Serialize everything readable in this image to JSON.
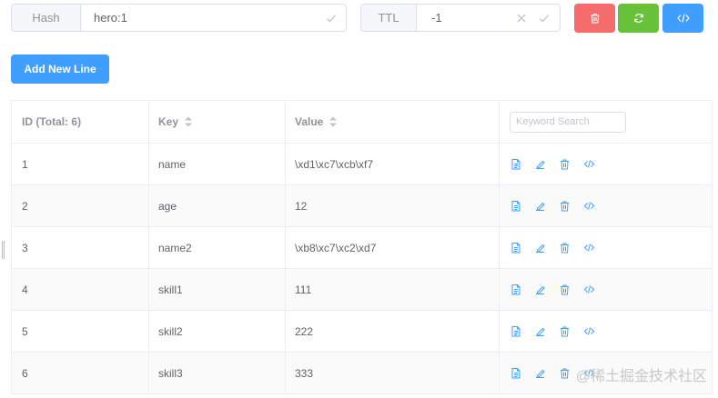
{
  "key_bar": {
    "type_label": "Hash",
    "key_name": "hero:1"
  },
  "ttl_bar": {
    "label": "TTL",
    "value": "-1"
  },
  "action_buttons": {
    "delete": "trash-icon",
    "refresh": "refresh-icon",
    "code": "code-icon"
  },
  "add_button": {
    "label": "Add New Line"
  },
  "table": {
    "headers": {
      "id": "ID (Total: 6)",
      "key": "Key",
      "value": "Value"
    },
    "search_placeholder": "Keyword Search",
    "rows": [
      {
        "id": "1",
        "key": "name",
        "value": "\\xd1\\xc7\\xcb\\xf7"
      },
      {
        "id": "2",
        "key": "age",
        "value": "12"
      },
      {
        "id": "3",
        "key": "name2",
        "value": "\\xb8\\xc7\\xc2\\xd7"
      },
      {
        "id": "4",
        "key": "skill1",
        "value": "111"
      },
      {
        "id": "5",
        "key": "skill2",
        "value": "222"
      },
      {
        "id": "6",
        "key": "skill3",
        "value": "333"
      }
    ],
    "row_ops": [
      "view-icon",
      "edit-icon",
      "delete-icon",
      "code-icon"
    ]
  },
  "watermark": "@稀土掘金技术社区",
  "colors": {
    "danger": "#f56c6c",
    "success": "#67c23a",
    "primary": "#409eff",
    "icon_blue": "#409eff"
  }
}
